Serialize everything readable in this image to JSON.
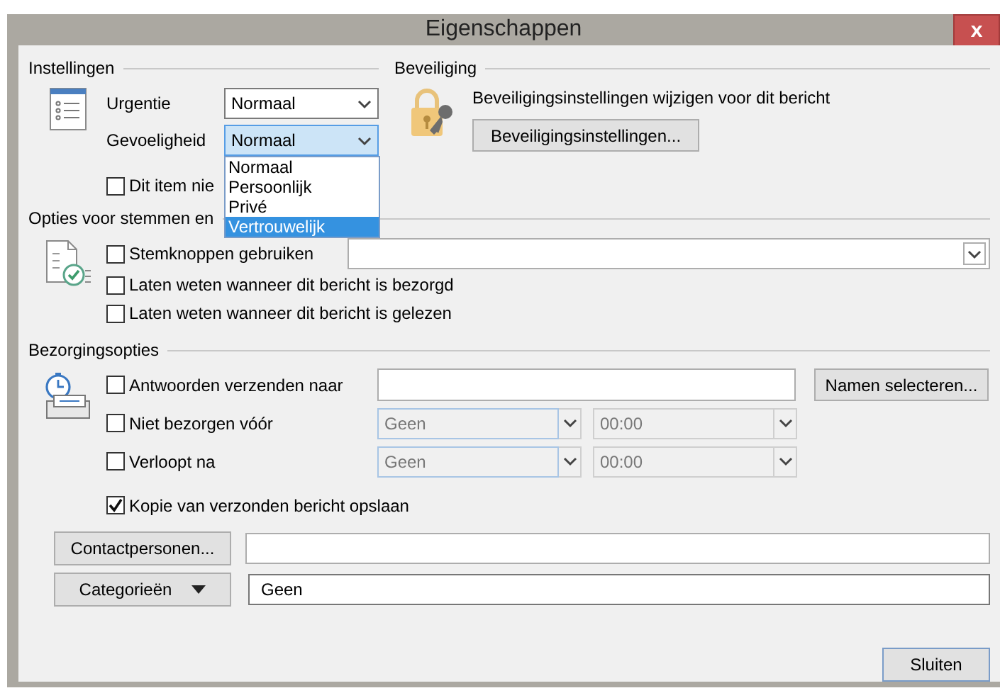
{
  "window": {
    "title": "Eigenschappen",
    "close": "x"
  },
  "settings": {
    "heading": "Instellingen",
    "fields": [
      {
        "label": "Urgentie",
        "value": "Normaal",
        "focused": false
      },
      {
        "label": "Gevoeligheid",
        "value": "Normaal",
        "focused": true
      }
    ],
    "checkbox": {
      "label": "Dit item nie",
      "checked": false
    },
    "dropdown_options": [
      {
        "label": "Normaal",
        "selected": false
      },
      {
        "label": "Persoonlijk",
        "selected": false
      },
      {
        "label": "Privé",
        "selected": false
      },
      {
        "label": "Vertrouwelijk",
        "selected": true
      }
    ]
  },
  "security": {
    "heading": "Beveiliging",
    "description": "Beveiligingsinstellingen wijzigen voor dit bericht",
    "button": "Beveiligingsinstellingen..."
  },
  "voting": {
    "heading": "Opties voor stemmen en",
    "options": [
      {
        "kind": "combo",
        "label": "Stemknoppen gebruiken",
        "checked": false
      },
      {
        "kind": "plain",
        "label": "Laten weten wanneer dit bericht is bezorgd",
        "checked": false
      },
      {
        "kind": "plain",
        "label": "Laten weten wanneer dit bericht is gelezen",
        "checked": false
      }
    ]
  },
  "delivery": {
    "heading": "Bezorgingsopties",
    "rows": [
      {
        "kind": "address",
        "label": "Antwoorden verzenden naar",
        "checked": false,
        "button": "Namen selecteren..."
      },
      {
        "kind": "datetime",
        "label": "Niet bezorgen vóór",
        "checked": false,
        "date": "Geen",
        "time": "00:00",
        "disabled": true
      },
      {
        "kind": "datetime",
        "label": "Verloopt na",
        "checked": false,
        "date": "Geen",
        "time": "00:00",
        "disabled": true
      },
      {
        "kind": "plain",
        "label": "Kopie van verzonden bericht opslaan",
        "checked": true
      }
    ]
  },
  "contacts": {
    "button": "Contactpersonen..."
  },
  "categories": {
    "button": "Categorieën",
    "value": "Geen"
  },
  "close_button": "Sluiten"
}
